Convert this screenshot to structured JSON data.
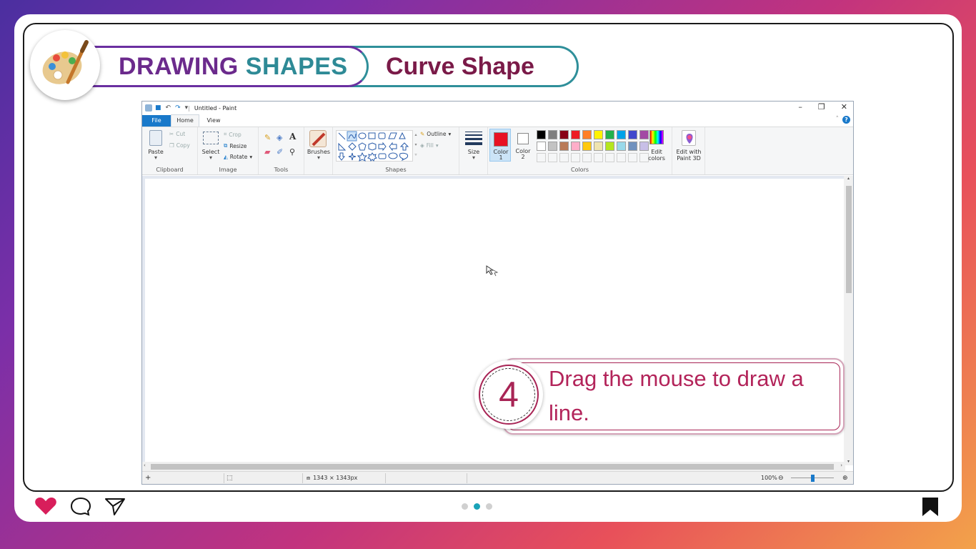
{
  "banner": {
    "title_part1": "DRAWING",
    "title_part2": "SHAPES",
    "subtitle": "Curve Shape"
  },
  "paint": {
    "window_title": "Untitled - Paint",
    "menu": {
      "file": "File",
      "home": "Home",
      "view": "View"
    },
    "help": "?",
    "clipboard": {
      "paste": "Paste",
      "cut": "Cut",
      "copy": "Copy",
      "label": "Clipboard"
    },
    "image": {
      "select": "Select",
      "crop": "Crop",
      "resize": "Resize",
      "rotate": "Rotate",
      "label": "Image"
    },
    "tools": {
      "label": "Tools"
    },
    "brushes": {
      "label": "Brushes"
    },
    "shapes": {
      "outline": "Outline",
      "fill": "Fill",
      "label": "Shapes"
    },
    "size": {
      "label": "Size"
    },
    "colors": {
      "color1_label": "Color",
      "color1_num": "1",
      "color2_label": "Color",
      "color2_num": "2",
      "edit_colors": "Edit colors",
      "edit_paint3d": "Edit with Paint 3D",
      "label": "Colors",
      "color1_value": "#e81123",
      "color2_value": "#ffffff",
      "palette_row1": [
        "#000000",
        "#7f7f7f",
        "#880015",
        "#ed1c24",
        "#ff7f27",
        "#fff200",
        "#22b14c",
        "#00a2e8",
        "#3f48cc",
        "#a349a4"
      ],
      "palette_row2": [
        "#ffffff",
        "#c3c3c3",
        "#b97a57",
        "#ffaec9",
        "#ffc90e",
        "#efe4b0",
        "#b5e61d",
        "#99d9ea",
        "#7092be",
        "#c8bfe7"
      ]
    },
    "status": {
      "dimensions": "1343 × 1343px",
      "zoom": "100%"
    }
  },
  "callout": {
    "step": "4",
    "text": "Drag the mouse to draw a line."
  },
  "colors": {
    "accent": "#b3245a",
    "teal": "#2e8a96",
    "purple": "#6b2a8c"
  }
}
